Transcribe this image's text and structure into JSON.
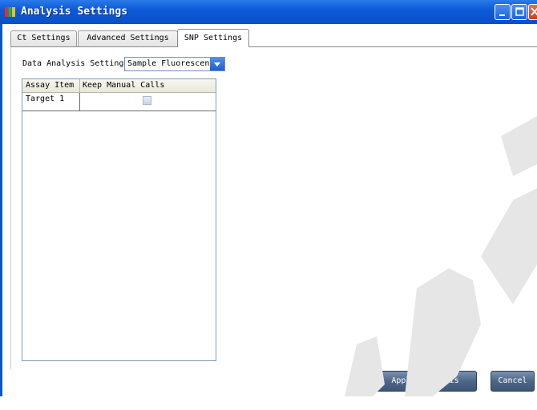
{
  "window": {
    "title": "Analysis Settings",
    "controls": [
      "minimize-icon",
      "maximize-icon",
      "close-icon"
    ]
  },
  "tabs": [
    {
      "label": "Ct Settings",
      "active": false
    },
    {
      "label": "Advanced Settings",
      "active": false
    },
    {
      "label": "SNP Settings",
      "active": true
    }
  ],
  "snp": {
    "data_analysis_label": "Data Analysis Settings",
    "data_analysis_value": "Sample Fluorescence",
    "grid": {
      "columns": [
        "Assay Item",
        "Keep Manual Calls"
      ],
      "rows": [
        {
          "assay_item": "Target 1",
          "keep_manual_calls": false
        }
      ]
    }
  },
  "buttons": {
    "apply": "Apply Analysis Settings",
    "cancel": "Cancel"
  },
  "colors": {
    "titlebar": "#0d5ad8",
    "button": "#4e6788",
    "dropdown_arrow": "#1f5fcf"
  }
}
